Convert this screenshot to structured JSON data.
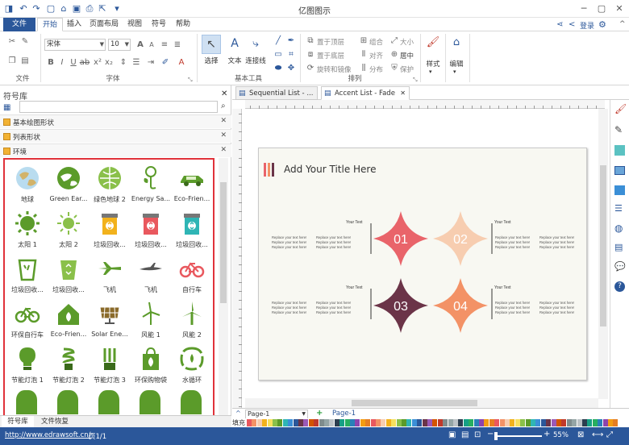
{
  "app": {
    "title": "亿图图示"
  },
  "tabs": [
    "文件",
    "开始",
    "插入",
    "页面布局",
    "视图",
    "符号",
    "帮助"
  ],
  "account": {
    "login": "登录"
  },
  "ribbon": {
    "groups": {
      "file": "文件",
      "font": "字体",
      "basic_tools": "基本工具",
      "arrange": "排列"
    },
    "font_name": "宋体",
    "font_size": "10",
    "tools": {
      "select": "选择",
      "text": "文本",
      "connector": "连接线"
    },
    "arrange": {
      "bring_top": "置于顶层",
      "group": "组合",
      "size": "大小",
      "send_bottom": "置于底层",
      "align": "对齐",
      "center": "居中",
      "rotate_mirror": "旋转和镜像",
      "distribute": "分布",
      "protect": "保护"
    },
    "style": "样式",
    "edit": "编辑"
  },
  "left_panel": {
    "title": "符号库",
    "libraries": [
      "基本绘图形状",
      "列表形状",
      "环境"
    ],
    "shapes": [
      {
        "label": "地球",
        "icon": "earth-icon"
      },
      {
        "label": "Green Ear...",
        "icon": "green-earth-icon"
      },
      {
        "label": "绿色地球 2",
        "icon": "green-earth-2-icon"
      },
      {
        "label": "Energy Sa...",
        "icon": "energy-saving-icon"
      },
      {
        "label": "Eco-Frien...",
        "icon": "eco-car-icon"
      },
      {
        "label": "太阳 1",
        "icon": "sun-1-icon"
      },
      {
        "label": "太阳 2",
        "icon": "sun-2-icon"
      },
      {
        "label": "垃圾回收...",
        "icon": "recycle-bin-yellow-icon"
      },
      {
        "label": "垃圾回收...",
        "icon": "recycle-bin-red-icon"
      },
      {
        "label": "垃圾回收...",
        "icon": "recycle-bin-teal-icon"
      },
      {
        "label": "垃圾回收...",
        "icon": "trash-bin-green-icon"
      },
      {
        "label": "垃圾回收...",
        "icon": "trash-bin-lime-icon"
      },
      {
        "label": "飞机",
        "icon": "airplane-1-icon"
      },
      {
        "label": "飞机",
        "icon": "airplane-2-icon"
      },
      {
        "label": "自行车",
        "icon": "bicycle-red-icon"
      },
      {
        "label": "环保自行车",
        "icon": "eco-bicycle-icon"
      },
      {
        "label": "Eco-Frien...",
        "icon": "eco-house-icon"
      },
      {
        "label": "Solar Ene...",
        "icon": "solar-panel-icon"
      },
      {
        "label": "风能 1",
        "icon": "wind-turbine-1-icon"
      },
      {
        "label": "风能 2",
        "icon": "wind-turbine-2-icon"
      },
      {
        "label": "节能灯泡 1",
        "icon": "bulb-1-icon"
      },
      {
        "label": "节能灯泡 2",
        "icon": "bulb-2-icon"
      },
      {
        "label": "节能灯泡 3",
        "icon": "bulb-3-icon"
      },
      {
        "label": "环保购物袋",
        "icon": "eco-bag-icon"
      },
      {
        "label": "水循环",
        "icon": "water-cycle-icon"
      }
    ],
    "bottom_tabs": [
      "符号库",
      "文件恢复"
    ]
  },
  "doc_tabs": [
    "Sequential List - ...",
    "Accent List - Fade"
  ],
  "diagram": {
    "title": "Add Your Title Here",
    "items": [
      {
        "num": "01",
        "color": "#e9646a"
      },
      {
        "num": "02",
        "color": "#f7cdb0"
      },
      {
        "num": "03",
        "color": "#6b3448"
      },
      {
        "num": "04",
        "color": "#f39266"
      }
    ],
    "your_text": "Your Text",
    "placeholder": "Replace your text here!"
  },
  "page_bar": {
    "page_select": "Page-1",
    "page_tab": "Page-1",
    "fill_label": "填充"
  },
  "status": {
    "url": "http://www.edrawsoft.cn/",
    "page": "页1/1",
    "zoom": "55%"
  }
}
